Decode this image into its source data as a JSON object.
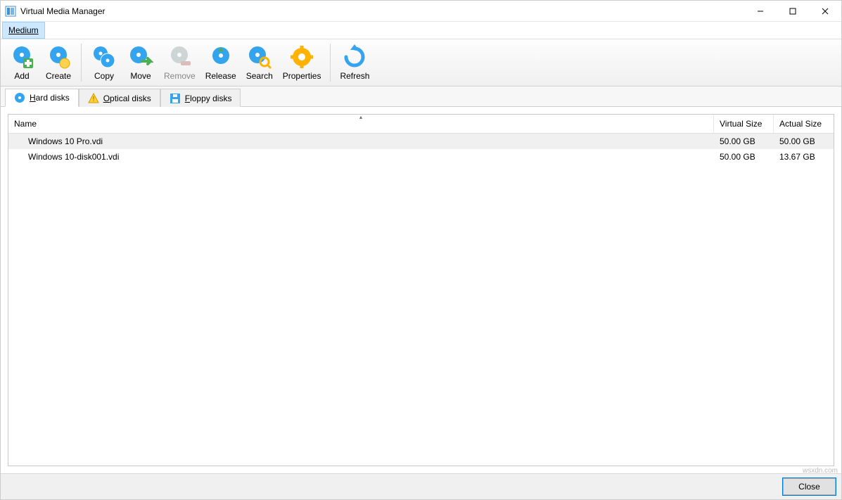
{
  "window": {
    "title": "Virtual Media Manager"
  },
  "menu": {
    "medium": "Medium"
  },
  "toolbar": {
    "add": "Add",
    "create": "Create",
    "copy": "Copy",
    "move": "Move",
    "remove": "Remove",
    "release": "Release",
    "search": "Search",
    "properties": "Properties",
    "refresh": "Refresh"
  },
  "tabs": {
    "hard_disks": "Hard disks",
    "optical_disks": "Optical disks",
    "floppy_disks": "Floppy disks"
  },
  "columns": {
    "name": "Name",
    "virtual_size": "Virtual Size",
    "actual_size": "Actual Size"
  },
  "rows": [
    {
      "name": "Windows 10 Pro.vdi",
      "virtual_size": "50.00 GB",
      "actual_size": "50.00 GB",
      "selected": true
    },
    {
      "name": "Windows 10-disk001.vdi",
      "virtual_size": "50.00 GB",
      "actual_size": "13.67 GB",
      "selected": false
    }
  ],
  "footer": {
    "close": "Close"
  },
  "watermark": "wsxdn.com"
}
